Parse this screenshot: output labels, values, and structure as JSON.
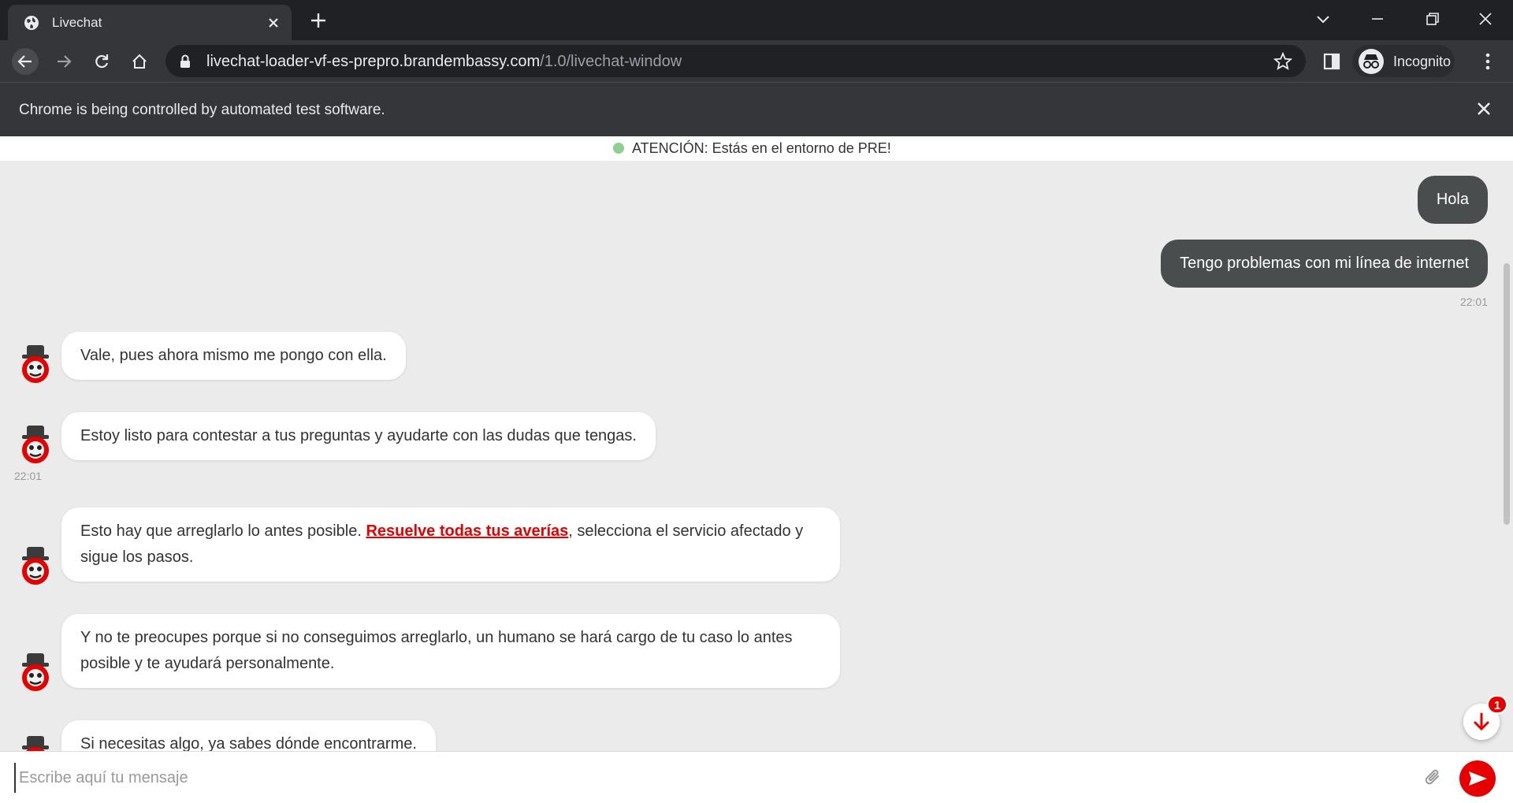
{
  "browser": {
    "tab_title": "Livechat",
    "url_host": "livechat-loader-vf-es-prepro.brandembassy.com",
    "url_path": "/1.0/livechat-window",
    "profile_label": "Incognito",
    "infobar_text": "Chrome is being controlled by automated test software."
  },
  "page": {
    "env_banner": "ATENCIÓN: Estás en el entorno de PRE!"
  },
  "messages": {
    "user_1": "Hola",
    "user_2": "Tengo problemas con mi línea de internet",
    "user_time": "22:01",
    "bot_1": "Vale, pues ahora mismo me pongo con ella.",
    "bot_2": "Estoy listo para contestar a tus preguntas y ayudarte con las dudas que tengas.",
    "bot_time": "22:01",
    "bot_3_before": "Esto hay que arreglarlo lo antes posible. ",
    "bot_3_link": "Resuelve todas tus averías",
    "bot_3_after": ", selecciona el servicio afectado y sigue los pasos.",
    "bot_4": "Y no te preocupes porque si no conseguimos arreglarlo, un humano se hará cargo de tu caso lo antes posible y te ayudará personalmente.",
    "bot_5": "Si necesitas algo, ya sabes dónde encontrarme."
  },
  "unread_count": "1",
  "composer": {
    "placeholder": "Escribe aquí tu mensaje",
    "value": ""
  },
  "colors": {
    "brand_red": "#e60000",
    "user_bubble": "#4a4d4e",
    "chat_background": "#ebebeb"
  },
  "icons": [
    "globe-icon",
    "close-icon",
    "plus-icon",
    "back-icon",
    "forward-icon",
    "reload-icon",
    "home-icon",
    "lock-icon",
    "star-icon",
    "side-panel-icon",
    "incognito-icon",
    "kebab-menu-icon",
    "bot-avatar-icon",
    "arrow-down-icon",
    "paperclip-icon",
    "send-icon"
  ]
}
